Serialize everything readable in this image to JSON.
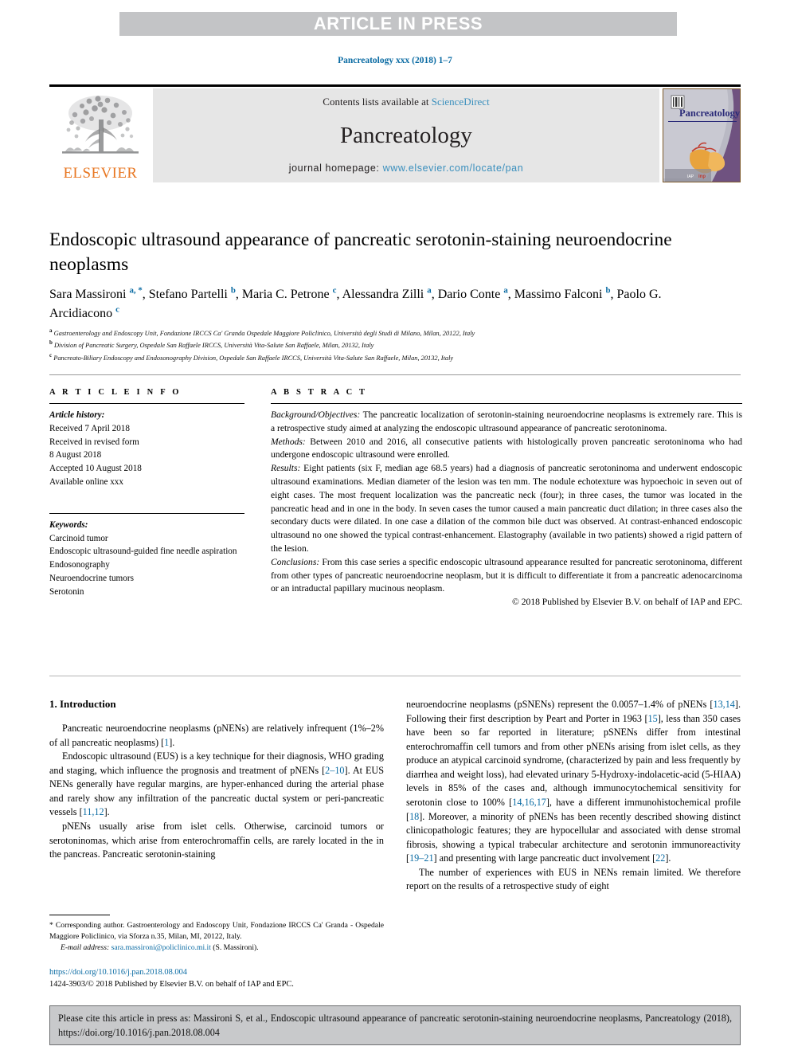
{
  "banner": {
    "label": "ARTICLE IN PRESS"
  },
  "journal_ref": "Pancreatology xxx (2018) 1–7",
  "masthead": {
    "publisher_name": "ELSEVIER",
    "contents_prefix": "Contents lists available at ",
    "contents_link": "ScienceDirect",
    "journal_name": "Pancreatology",
    "homepage_prefix": "journal homepage: ",
    "homepage_url": "www.elsevier.com/locate/pan",
    "cover_title": "Pancreatology"
  },
  "article": {
    "title": "Endoscopic ultrasound appearance of pancreatic serotonin-staining neuroendocrine neoplasms",
    "authors": [
      {
        "name": "Sara Massironi",
        "marks": "a, *"
      },
      {
        "name": "Stefano Partelli",
        "marks": "b"
      },
      {
        "name": "Maria C. Petrone",
        "marks": "c"
      },
      {
        "name": "Alessandra Zilli",
        "marks": "a"
      },
      {
        "name": "Dario Conte",
        "marks": "a"
      },
      {
        "name": "Massimo Falconi",
        "marks": "b"
      },
      {
        "name": "Paolo G. Arcidiacono",
        "marks": "c"
      }
    ],
    "affiliations": [
      {
        "mark": "a",
        "text": "Gastroenterology and Endoscopy Unit, Fondazione IRCCS Ca' Granda Ospedale Maggiore Policlinico, Università degli Studi di Milano, Milan, 20122, Italy"
      },
      {
        "mark": "b",
        "text": "Division of Pancreatic Surgery, Ospedale San Raffaele IRCCS, Università Vita-Salute San Raffaele, Milan, 20132, Italy"
      },
      {
        "mark": "c",
        "text": "Pancreato-Biliary Endoscopy and Endosonography Division, Ospedale San Raffaele IRCCS, Università Vita-Salute San Raffaele, Milan, 20132, Italy"
      }
    ]
  },
  "article_info": {
    "heading": "A R T I C L E  I N F O",
    "history_label": "Article history:",
    "history": [
      "Received 7 April 2018",
      "Received in revised form",
      "8 August 2018",
      "Accepted 10 August 2018",
      "Available online xxx"
    ],
    "keywords_label": "Keywords:",
    "keywords": [
      "Carcinoid tumor",
      "Endoscopic ultrasound-guided fine needle aspiration",
      "Endosonography",
      "Neuroendocrine tumors",
      "Serotonin"
    ]
  },
  "abstract": {
    "heading": "A B S T R A C T",
    "sections": [
      {
        "label": "Background/Objectives:",
        "text": " The pancreatic localization of serotonin-staining neuroendocrine neoplasms is extremely rare. This is a retrospective study aimed at analyzing the endoscopic ultrasound appearance of pancreatic serotoninoma."
      },
      {
        "label": "Methods:",
        "text": " Between 2010 and 2016, all consecutive patients with histologically proven pancreatic serotoninoma who had undergone endoscopic ultrasound were enrolled."
      },
      {
        "label": "Results:",
        "text": " Eight patients (six F, median age 68.5 years) had a diagnosis of pancreatic serotoninoma and underwent endoscopic ultrasound examinations. Median diameter of the lesion was ten mm. The nodule echotexture was hypoechoic in seven out of eight cases. The most frequent localization was the pancreatic neck (four); in three cases, the tumor was located in the pancreatic head and in one in the body. In seven cases the tumor caused a main pancreatic duct dilation; in three cases also the secondary ducts were dilated. In one case a dilation of the common bile duct was observed. At contrast-enhanced endoscopic ultrasound no one showed the typical contrast-enhancement. Elastography (available in two patients) showed a rigid pattern of the lesion."
      },
      {
        "label": "Conclusions:",
        "text": " From this case series a specific endoscopic ultrasound appearance resulted for pancreatic serotoninoma, different from other types of pancreatic neuroendocrine neoplasm, but it is difficult to differentiate it from a pancreatic adenocarcinoma or an intraductal papillary mucinous neoplasm."
      }
    ],
    "copyright": "© 2018 Published by Elsevier B.V. on behalf of IAP and EPC."
  },
  "introduction": {
    "heading": "1. Introduction",
    "left_paragraphs": [
      "Pancreatic neuroendocrine neoplasms (pNENs) are relatively infrequent (1%–2% of all pancreatic neoplasms) [1].",
      "Endoscopic ultrasound (EUS) is a key technique for their diagnosis, WHO grading and staging, which influence the prognosis and treatment of pNENs [2–10]. At EUS NENs generally have regular margins, are hyper-enhanced during the arterial phase and rarely show any infiltration of the pancreatic ductal system or peri-pancreatic vessels [11,12].",
      "pNENs usually arise from islet cells. Otherwise, carcinoid tumors or serotoninomas, which arise from enterochromaffin cells, are rarely located in the in the pancreas. Pancreatic serotonin-staining"
    ],
    "right_paragraphs": [
      "neuroendocrine neoplasms (pSNENs) represent the 0.0057–1.4% of pNENs [13,14]. Following their first description by Peart and Porter in 1963 [15], less than 350 cases have been so far reported in literature; pSNENs differ from intestinal enterochromaffin cell tumors and from other pNENs arising from islet cells, as they produce an atypical carcinoid syndrome, (characterized by pain and less frequently by diarrhea and weight loss), had elevated urinary 5-Hydroxy-indolacetic-acid (5-HIAA) levels in 85% of the cases and, although immunocytochemical sensitivity for serotonin close to 100% [14,16,17], have a different immunohistochemical profile [18]. Moreover, a minority of pNENs has been recently described showing distinct clinicopathologic features; they are hypocellular and associated with dense stromal fibrosis, showing a typical trabecular architecture and serotonin immunoreactivity [19–21] and presenting with large pancreatic duct involvement [22].",
      "The number of experiences with EUS in NENs remain limited. We therefore report on the results of a retrospective study of eight"
    ]
  },
  "footnote": {
    "corresponding": "* Corresponding author. Gastroenterology and Endoscopy Unit, Fondazione IRCCS Ca' Granda - Ospedale Maggiore Policlinico, via Sforza n.35, Milan, MI, 20122, Italy.",
    "email_label": "E-mail address:",
    "email": "sara.massironi@policlinico.mi.it",
    "email_owner": "(S. Massironi).",
    "doi": "https://doi.org/10.1016/j.pan.2018.08.004",
    "issn_line": "1424-3903/© 2018 Published by Elsevier B.V. on behalf of IAP and EPC."
  },
  "citation_box": {
    "text": "Please cite this article in press as: Massironi S, et al., Endoscopic ultrasound appearance of pancreatic serotonin-staining neuroendocrine neoplasms, Pancreatology (2018), https://doi.org/10.1016/j.pan.2018.08.004"
  },
  "colors": {
    "banner_bg": "#c3c4c6",
    "link_blue": "#0a6ba3",
    "band_gray": "#e6e6e6",
    "elsevier_orange": "#e87722",
    "cite_bg": "#c8c9cb"
  }
}
